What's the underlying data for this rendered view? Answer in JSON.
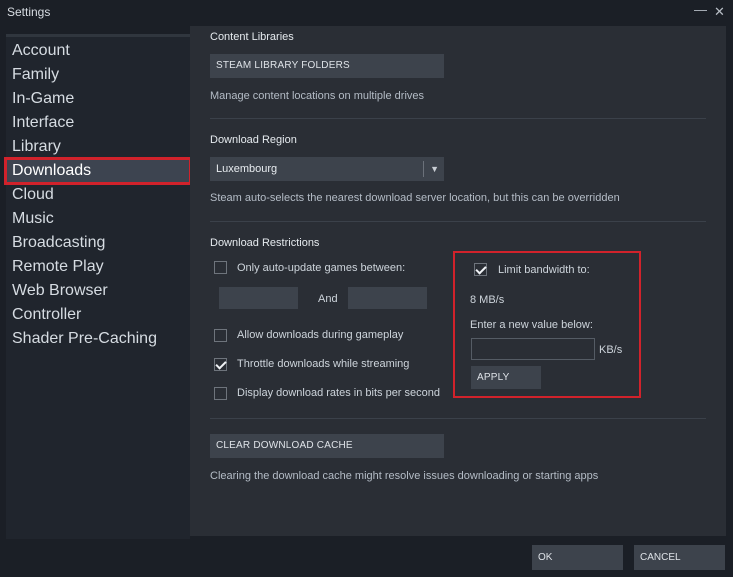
{
  "window": {
    "title": "Settings",
    "minimize_glyph": "—",
    "close_glyph": "✕"
  },
  "sidebar": {
    "items": [
      {
        "label": "Account"
      },
      {
        "label": "Family"
      },
      {
        "label": "In-Game"
      },
      {
        "label": "Interface"
      },
      {
        "label": "Library"
      },
      {
        "label": "Downloads",
        "active": true
      },
      {
        "label": "Cloud"
      },
      {
        "label": "Music"
      },
      {
        "label": "Broadcasting"
      },
      {
        "label": "Remote Play"
      },
      {
        "label": "Web Browser"
      },
      {
        "label": "Controller"
      },
      {
        "label": "Shader Pre-Caching"
      }
    ]
  },
  "content_libraries": {
    "title": "Content Libraries",
    "button_label": "STEAM LIBRARY FOLDERS",
    "description": "Manage content locations on multiple drives"
  },
  "download_region": {
    "title": "Download Region",
    "selected": "Luxembourg",
    "description": "Steam auto-selects the nearest download server location, but this can be overridden"
  },
  "download_restrictions": {
    "title": "Download Restrictions",
    "auto_update": {
      "label": "Only auto-update games between:",
      "checked": false,
      "start": "",
      "end": "",
      "and_label": "And"
    },
    "allow_during_gameplay": {
      "label": "Allow downloads during gameplay",
      "checked": false
    },
    "throttle_streaming": {
      "label": "Throttle downloads while streaming",
      "checked": true
    },
    "bits_per_second": {
      "label": "Display download rates in bits per second",
      "checked": false
    },
    "bandwidth": {
      "label": "Limit bandwidth to:",
      "checked": true,
      "current_value": "8 MB/s",
      "prompt": "Enter a new value below:",
      "input_value": "",
      "unit": "KB/s",
      "apply_label": "APPLY"
    }
  },
  "cache": {
    "button_label": "CLEAR DOWNLOAD CACHE",
    "description": "Clearing the download cache might resolve issues downloading or starting apps"
  },
  "footer": {
    "ok_label": "OK",
    "cancel_label": "CANCEL"
  },
  "colors": {
    "highlight_red": "#d1222b",
    "panel_bg": "#2a2e35",
    "sidebar_bg": "#20252d",
    "window_bg": "#1b1f26"
  }
}
